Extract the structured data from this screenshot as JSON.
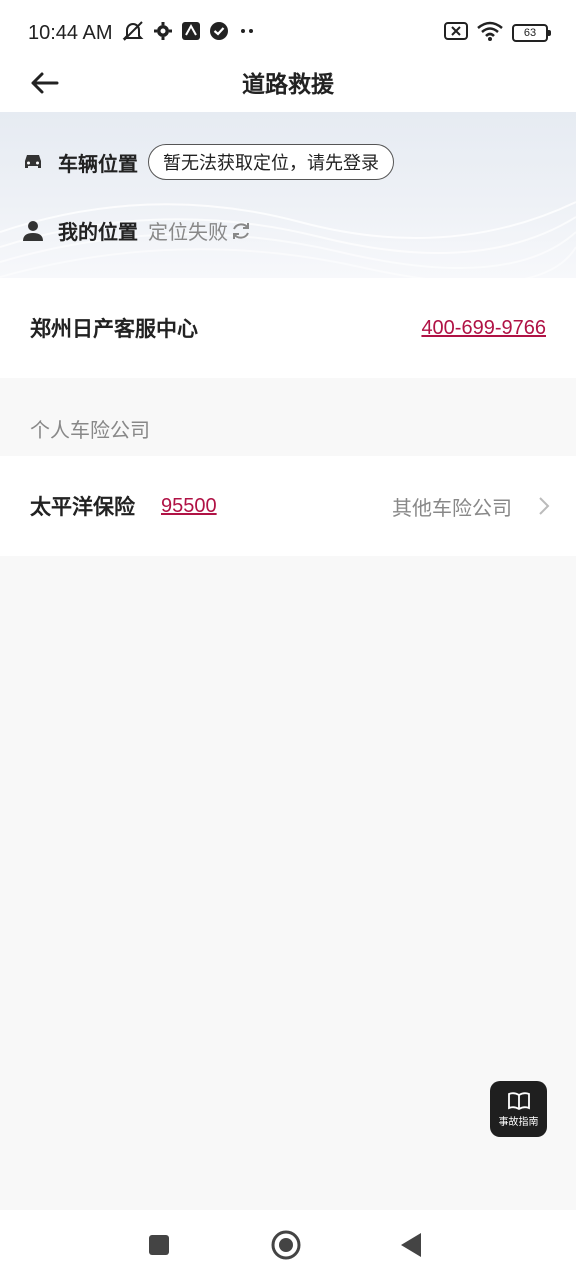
{
  "status_bar": {
    "time": "10:44 AM",
    "battery": "63",
    "icons": [
      "bell-off-icon",
      "settings-icon",
      "app-icon",
      "check-circle-icon",
      "more-dots-icon",
      "sim-x-icon",
      "wifi-icon",
      "battery-icon"
    ]
  },
  "header": {
    "title": "道路救援"
  },
  "location": {
    "vehicle_label": "车辆位置",
    "vehicle_status": "暂无法获取定位，请先登录",
    "my_label": "我的位置",
    "my_status": "定位失败"
  },
  "service_center": {
    "name": "郑州日产客服中心",
    "phone": "400-699-9766"
  },
  "personal_insurance": {
    "section_title": "个人车险公司",
    "company_name": "太平洋保险",
    "company_phone": "95500",
    "other_label": "其他车险公司"
  },
  "floating": {
    "guide_label": "事故指南"
  },
  "colors": {
    "accent": "#b01245",
    "background": "#f8f8f8"
  }
}
